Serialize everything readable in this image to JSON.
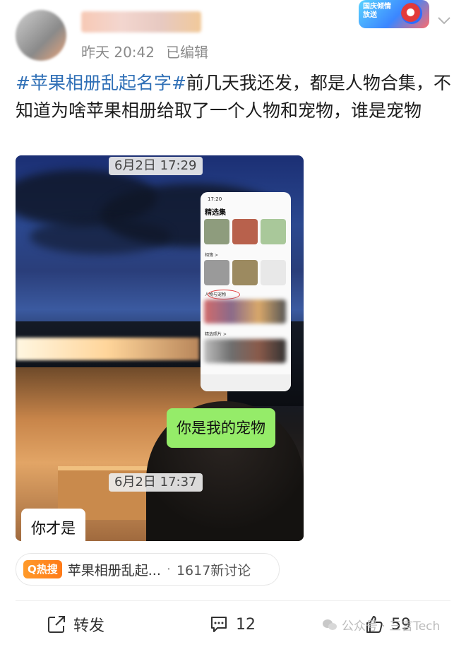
{
  "header": {
    "time": "昨天 20:42",
    "edited": "已编辑",
    "badge_text": "国庆倾情放送"
  },
  "post": {
    "topic": "#苹果相册乱起名字#",
    "text": "前几天我还发，都是人物合集，不知道为啥苹果相册给取了一个人物和宠物，谁是宠物"
  },
  "image": {
    "timestamp_1": "6月2日 17:29",
    "timestamp_2": "6月2日 17:37",
    "bubble_green": "你是我的宠物",
    "bubble_white": "你才是",
    "phone": {
      "time": "17:20",
      "title": "精选集",
      "section_albums": "相簿 >",
      "section_people": "人物与宠物",
      "section_featured": "精选照片 >"
    }
  },
  "hot_search": {
    "badge": "Q热搜",
    "topic": "苹果相册乱起...",
    "count": "1617新讨论"
  },
  "actions": {
    "repost_label": "转发",
    "comment_count": "12",
    "like_count": "59"
  },
  "watermark": {
    "text": "公众号 · 三言Tech"
  },
  "colors": {
    "topic_blue": "#2f6fb6",
    "hot_orange": "#ff7a18",
    "wechat_green": "#95ec69"
  }
}
